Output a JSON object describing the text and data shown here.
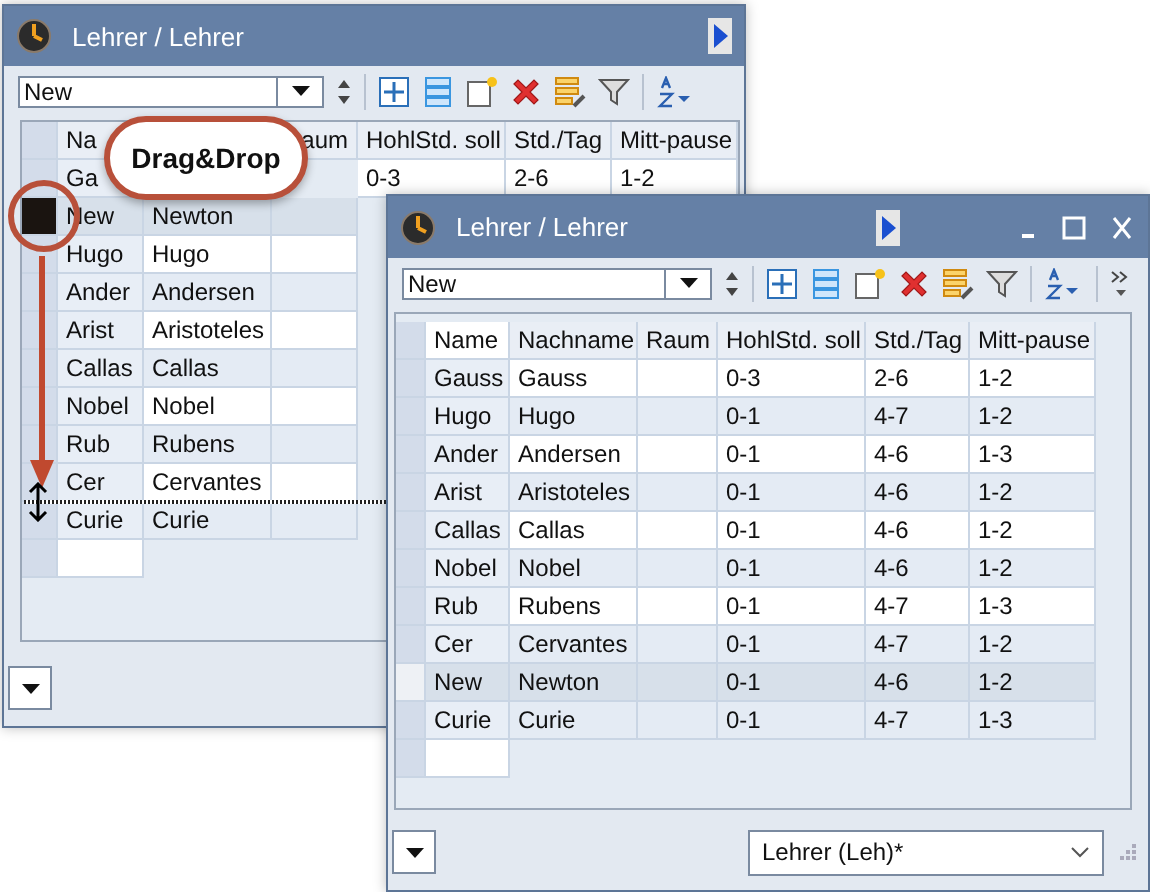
{
  "back_window": {
    "title": "Lehrer / Lehrer",
    "selector": "New",
    "header": [
      "Na",
      "aum",
      "HohlStd. soll",
      "Std./Tag",
      "Mitt-pause"
    ],
    "rows": [
      {
        "name": "Ga",
        "hohlstd": "0-3",
        "std_tag": "2-6",
        "mitt_pause": "1-2",
        "selected": false
      },
      {
        "name": "New",
        "nachname": "Newton",
        "selected": true
      },
      {
        "name": "Hugo",
        "nachname": "Hugo",
        "selected": false
      },
      {
        "name": "Ander",
        "nachname": "Andersen",
        "selected": false
      },
      {
        "name": "Arist",
        "nachname": "Aristoteles",
        "selected": false
      },
      {
        "name": "Callas",
        "nachname": "Callas",
        "selected": false
      },
      {
        "name": "Nobel",
        "nachname": "Nobel",
        "selected": false
      },
      {
        "name": "Rub",
        "nachname": "Rubens",
        "selected": false
      },
      {
        "name": "Cer",
        "nachname": "Cervantes",
        "selected": false
      },
      {
        "name": "Curie",
        "nachname": "Curie",
        "selected": false
      }
    ]
  },
  "drag_label": "Drag&Drop",
  "front_window": {
    "title": "Lehrer / Lehrer",
    "selector": "New",
    "columns": [
      "Name",
      "Nachname",
      "Raum",
      "HohlStd. soll",
      "Std./Tag",
      "Mitt-pause"
    ],
    "rows": [
      {
        "name": "Gauss",
        "nachname": "Gauss",
        "hohlstd": "0-3",
        "std_tag": "2-6",
        "mitt_pause": "1-2",
        "selected": false
      },
      {
        "name": "Hugo",
        "nachname": "Hugo",
        "hohlstd": "0-1",
        "std_tag": "4-7",
        "mitt_pause": "1-2",
        "selected": false
      },
      {
        "name": "Ander",
        "nachname": "Andersen",
        "hohlstd": "0-1",
        "std_tag": "4-6",
        "mitt_pause": "1-3",
        "selected": false
      },
      {
        "name": "Arist",
        "nachname": "Aristoteles",
        "hohlstd": "0-1",
        "std_tag": "4-6",
        "mitt_pause": "1-2",
        "selected": false
      },
      {
        "name": "Callas",
        "nachname": "Callas",
        "hohlstd": "0-1",
        "std_tag": "4-6",
        "mitt_pause": "1-2",
        "selected": false
      },
      {
        "name": "Nobel",
        "nachname": "Nobel",
        "hohlstd": "0-1",
        "std_tag": "4-6",
        "mitt_pause": "1-2",
        "selected": false
      },
      {
        "name": "Rub",
        "nachname": "Rubens",
        "hohlstd": "0-1",
        "std_tag": "4-7",
        "mitt_pause": "1-3",
        "selected": false
      },
      {
        "name": "Cer",
        "nachname": "Cervantes",
        "hohlstd": "0-1",
        "std_tag": "4-7",
        "mitt_pause": "1-2",
        "selected": false
      },
      {
        "name": "New",
        "nachname": "Newton",
        "hohlstd": "0-1",
        "std_tag": "4-6",
        "mitt_pause": "1-2",
        "selected": true
      },
      {
        "name": "Curie",
        "nachname": "Curie",
        "hohlstd": "0-1",
        "std_tag": "4-7",
        "mitt_pause": "1-3",
        "selected": false
      }
    ],
    "view": "Lehrer (Leh)*"
  }
}
